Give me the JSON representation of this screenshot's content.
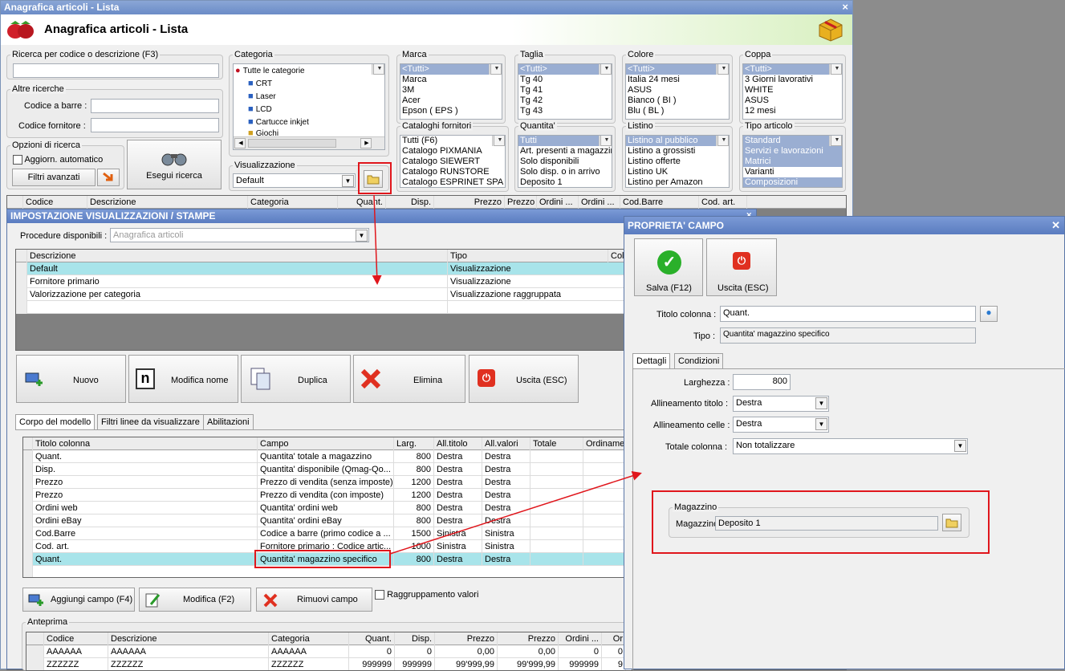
{
  "main": {
    "window_title": "Anagrafica articoli  - Lista",
    "header_title": "Anagrafica articoli  - Lista",
    "close": "×"
  },
  "search": {
    "group": "Ricerca per codice o descrizione (F3)",
    "value": "",
    "altre": "Altre ricerche",
    "barcode_label": "Codice a barre :",
    "supplier_label": "Codice fornitore :",
    "options": "Opzioni di ricerca",
    "auto_update": "Aggiorn. automatico",
    "advanced": "Filtri avanzati",
    "run": "Esegui ricerca"
  },
  "categoria": {
    "label": "Categoria",
    "items": [
      "Tutte le categorie",
      "CRT",
      "Laser",
      "LCD",
      "Cartucce inkjet",
      "Giochi"
    ]
  },
  "visualizzazione": {
    "label": "Visualizzazione",
    "value": "Default"
  },
  "filters": {
    "marca": {
      "label": "Marca",
      "items": [
        "<Tutti>",
        "Marca",
        "3M",
        "Acer",
        "Epson ( EPS )"
      ]
    },
    "taglia": {
      "label": "Taglia",
      "items": [
        "<Tutti>",
        "Tg 40",
        "Tg 41",
        "Tg 42",
        "Tg 43"
      ]
    },
    "colore": {
      "label": "Colore",
      "items": [
        "<Tutti>",
        "Italia 24 mesi",
        "ASUS",
        "Bianco ( BI )",
        "Blu ( BL )"
      ]
    },
    "coppa": {
      "label": "Coppa",
      "items": [
        "<Tutti>",
        "3 Giorni lavorativi",
        "WHITE",
        "ASUS",
        "12 mesi"
      ]
    },
    "cataloghi": {
      "label": "Cataloghi fornitori",
      "items": [
        "Tutti (F6)",
        "Catalogo PIXMANIA",
        "Catalogo SIEWERT",
        "Catalogo RUNSTORE",
        "Catalogo ESPRINET SPA"
      ]
    },
    "quantita": {
      "label": "Quantita'",
      "items": [
        "Tutti",
        "Art. presenti a magazzino",
        "Solo disponibili",
        "Solo disp. o in arrivo",
        "Deposito 1"
      ]
    },
    "listino": {
      "label": "Listino",
      "items": [
        "Listino al pubblico",
        "Listino a grossisti",
        "Listino offerte",
        "Listino UK",
        "Listino per Amazon"
      ]
    },
    "tipo": {
      "label": "Tipo articolo",
      "items": [
        "Standard",
        "Servizi e lavorazioni",
        "Matrici",
        "Varianti",
        "Composizioni"
      ]
    }
  },
  "list_header": [
    "Codice",
    "Descrizione",
    "Categoria",
    "Quant.",
    "Disp.",
    "Prezzo",
    "Prezzo",
    "Ordini ...",
    "Ordini ...",
    "Cod.Barre",
    "Cod. art."
  ],
  "impost": {
    "title": "IMPOSTAZIONE VISUALIZZAZIONI / STAMPE",
    "procedure_label": "Procedure disponibili :",
    "procedure_value": "Anagrafica articoli",
    "grid_header": [
      "Descrizione",
      "Tipo",
      "Colo"
    ],
    "grid_rows": [
      [
        "Default",
        "Visualizzazione"
      ],
      [
        "Fornitore primario",
        "Visualizzazione"
      ],
      [
        "Valorizzazione per categoria",
        "Visualizzazione raggruppata"
      ]
    ],
    "buttons": {
      "nuovo": "Nuovo",
      "modifica": "Modifica nome",
      "duplica": "Duplica",
      "elimina": "Elimina",
      "uscita": "Uscita (ESC)"
    },
    "tabs": [
      "Corpo del modello",
      "Filtri linee da visualizzare",
      "Abilitazioni"
    ],
    "cols_header": [
      "Titolo colonna",
      "Campo",
      "Larg.",
      "All.titolo",
      "All.valori",
      "Totale",
      "Ordinamento"
    ],
    "cols_rows": [
      [
        "Quant.",
        "Quantita' totale a magazzino",
        "800",
        "Destra",
        "Destra"
      ],
      [
        "Disp.",
        "Quantita' disponibile (Qmag-Qo...",
        "800",
        "Destra",
        "Destra"
      ],
      [
        "Prezzo",
        "Prezzo di vendita (senza imposte)",
        "1200",
        "Destra",
        "Destra"
      ],
      [
        "Prezzo",
        "Prezzo di vendita (con imposte)",
        "1200",
        "Destra",
        "Destra"
      ],
      [
        "Ordini web",
        "Quantita' ordini web",
        "800",
        "Destra",
        "Destra"
      ],
      [
        "Ordini eBay",
        "Quantita' ordini eBay",
        "800",
        "Destra",
        "Destra"
      ],
      [
        "Cod.Barre",
        "Codice a barre (primo codice a ...",
        "1500",
        "Sinistra",
        "Sinistra"
      ],
      [
        "Cod. art.",
        "Fornitore primario : Codice artic...",
        "1000",
        "Sinistra",
        "Sinistra"
      ],
      [
        "Quant.",
        "Quantita' magazzino specifico",
        "800",
        "Destra",
        "Destra"
      ]
    ],
    "add_field": "Aggiungi campo (F4)",
    "modify": "Modifica (F2)",
    "remove": "Rimuovi campo",
    "group_values": "Raggruppamento valori",
    "preview": "Anteprima",
    "preview_header": [
      "Codice",
      "Descrizione",
      "Categoria",
      "Quant.",
      "Disp.",
      "Prezzo",
      "Prezzo",
      "Ordini ...",
      "Or"
    ],
    "preview_rows": [
      [
        "AAAAAA",
        "AAAAAA",
        "AAAAAA",
        "0",
        "0",
        "0,00",
        "0,00",
        "0",
        "0"
      ],
      [
        "ZZZZZZ",
        "ZZZZZZ",
        "ZZZZZZ",
        "999999",
        "999999",
        "99'999,99",
        "99'999,99",
        "999999",
        "9"
      ]
    ]
  },
  "prop": {
    "title": "PROPRIETA' CAMPO",
    "save": "Salva (F12)",
    "exit": "Uscita (ESC)",
    "col_title_label": "Titolo colonna :",
    "col_title": "Quant.",
    "type_label": "Tipo :",
    "type": "Quantita' magazzino specifico",
    "tabs": [
      "Dettagli",
      "Condizioni"
    ],
    "width_label": "Larghezza :",
    "width": "800",
    "align_title_label": "Allineamento titolo :",
    "align_title": "Destra",
    "align_cells_label": "Allineamento celle :",
    "align_cells": "Destra",
    "total_label": "Totale colonna :",
    "total": "Non totalizzare",
    "mag_group": "Magazzino",
    "mag_label": "Magazzino :",
    "mag_value": "Deposito 1"
  }
}
